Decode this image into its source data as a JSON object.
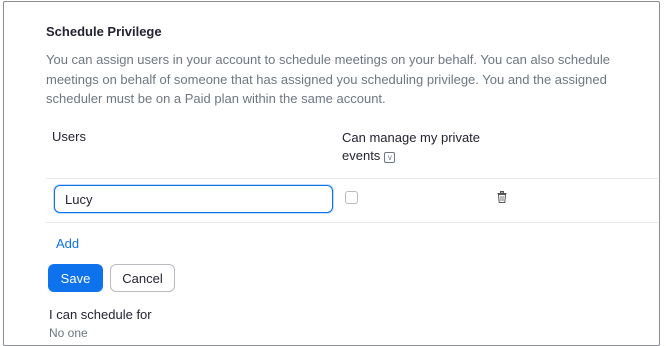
{
  "section": {
    "title": "Schedule Privilege",
    "description": "You can assign users in your account to schedule meetings on your behalf. You can also schedule meetings on behalf of someone that has assigned you scheduling privilege. You and the assigned scheduler must be on a Paid plan within the same account."
  },
  "table": {
    "col_users": "Users",
    "col_private": "Can manage my private events",
    "info_icon": "info-icon",
    "rows": [
      {
        "user": "Lucy",
        "private_checked": false,
        "delete_icon": "trash-icon"
      }
    ]
  },
  "actions": {
    "add_label": "Add",
    "save_label": "Save",
    "cancel_label": "Cancel"
  },
  "schedule_for": {
    "label": "I can schedule for",
    "value": "No one"
  },
  "colors": {
    "accent": "#0e72ed",
    "text": "#232333",
    "muted": "#6e7680"
  }
}
